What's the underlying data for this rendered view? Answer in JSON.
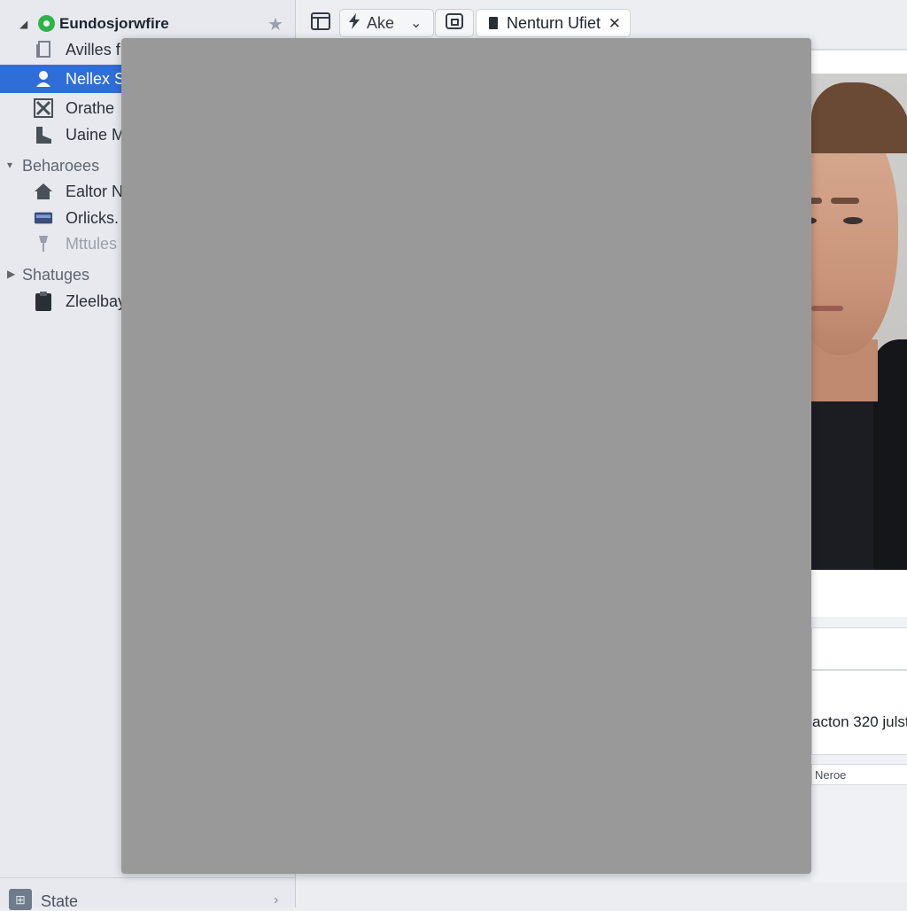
{
  "sidebar": {
    "header": {
      "title": "Eundosjorwfire"
    },
    "items": [
      {
        "label": "Avilles f",
        "icon": "file-icon"
      },
      {
        "label": "Nellex S",
        "icon": "person-icon",
        "selected": true
      },
      {
        "label": "Orathe",
        "icon": "close-box-icon"
      },
      {
        "label": "Uaine M",
        "icon": "page-icon"
      }
    ],
    "groups": [
      {
        "label": "Beharoees",
        "items": [
          {
            "label": "Ealtor N",
            "icon": "house-icon"
          },
          {
            "label": "Orlicks.",
            "icon": "drive-icon"
          },
          {
            "label": "Mttules",
            "icon": "tool-icon",
            "faded": true
          }
        ]
      },
      {
        "label": "Shatuges",
        "items": [
          {
            "label": "Zleelbay",
            "icon": "clipboard-icon"
          }
        ]
      }
    ],
    "footer": {
      "label": "State"
    }
  },
  "toolbar": {
    "button_label": "Ake",
    "active_tab": "Nenturn Ufiet"
  },
  "right_panel": {
    "caption": "acton 320 julst",
    "small_label": "Neroe"
  },
  "colors": {
    "selection": "#2f6ed8",
    "status_green": "#2fb24a",
    "overlay": "#999999"
  }
}
